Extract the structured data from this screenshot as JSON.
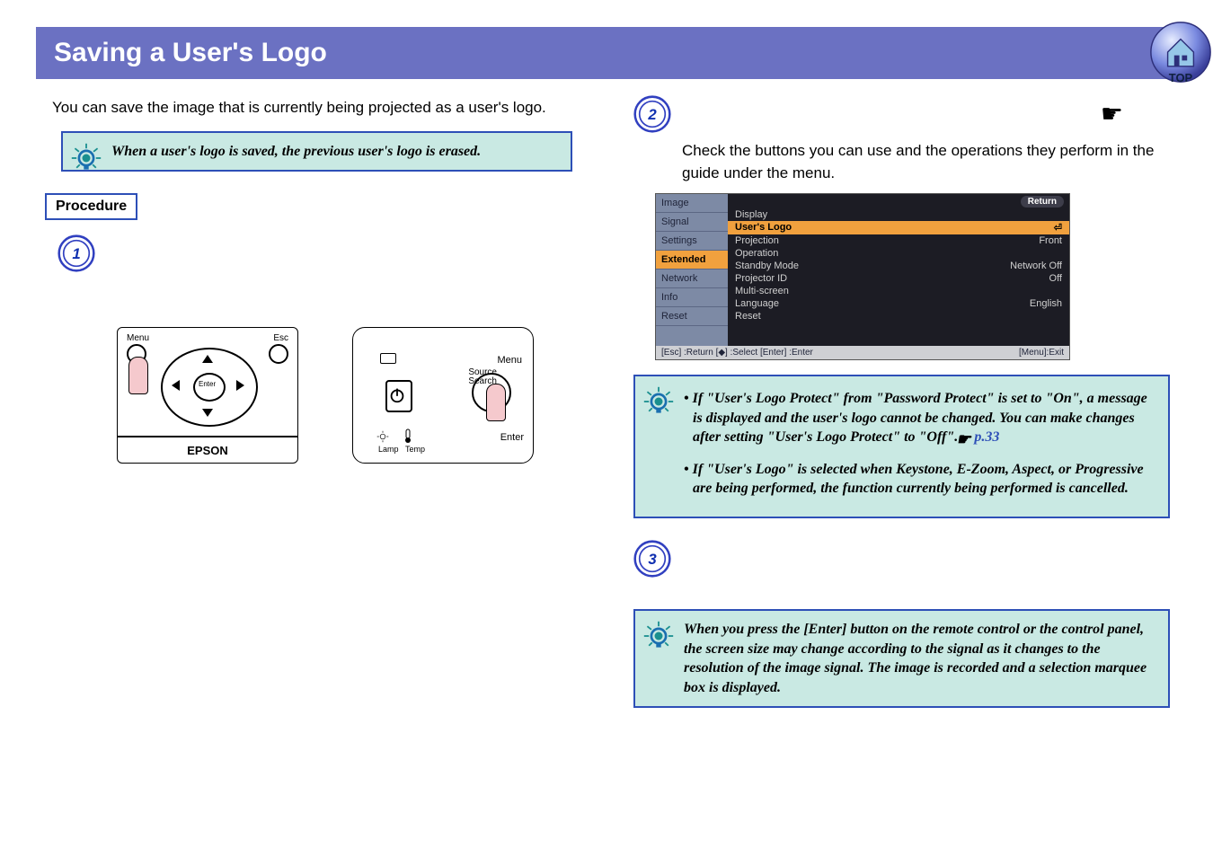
{
  "header": {
    "title": "Saving a User's Logo",
    "top_button": "TOP"
  },
  "left": {
    "intro": "You can save the image that is currently being projected as a user's logo.",
    "tip1": "When a user's logo is saved, the previous user's logo is erased.",
    "procedure_label": "Procedure",
    "step1_num": "1",
    "remote": {
      "menu": "Menu",
      "esc": "Esc",
      "enter": "Enter",
      "brand": "EPSON"
    },
    "panel": {
      "menu": "Menu",
      "source": "Source",
      "search": "Search",
      "enter": "Enter",
      "lamp": "Lamp",
      "temp": "Temp"
    }
  },
  "right": {
    "step2_num": "2",
    "step2_text": "Check the buttons you can use and the operations they perform in the guide under the menu.",
    "osd": {
      "sidebar": [
        "Image",
        "Signal",
        "Settings",
        "Extended",
        "Network",
        "Info",
        "Reset"
      ],
      "return": "Return",
      "items": [
        {
          "label": "Display",
          "value": ""
        },
        {
          "label": "User's Logo",
          "value": ""
        },
        {
          "label": "Projection",
          "value": "Front"
        },
        {
          "label": "Operation",
          "value": ""
        },
        {
          "label": "Standby Mode",
          "value": "Network Off"
        },
        {
          "label": "Projector ID",
          "value": "Off"
        },
        {
          "label": "Multi-screen",
          "value": ""
        },
        {
          "label": "Language",
          "value": "English"
        },
        {
          "label": "Reset",
          "value": ""
        }
      ],
      "footer_left": "[Esc] :Return  [◆] :Select  [Enter] :Enter",
      "footer_right": "[Menu]:Exit"
    },
    "tip2a": "If \"User's Logo Protect\" from \"Password Protect\" is set to \"On\", a message is displayed and the user's logo cannot be changed. You can make changes after setting \"User's Logo Protect\" to \"Off\".",
    "tip2a_ref": "p.33",
    "tip2b": "If \"User's Logo\" is selected when Keystone, E-Zoom, Aspect, or Progressive are being performed, the function currently being performed is cancelled.",
    "step3_num": "3",
    "tip3": "When you press the [Enter] button on the remote control or the control panel, the screen size may change according to the signal as it changes to the resolution of the image signal. The image is recorded and a selection marquee box is displayed."
  }
}
